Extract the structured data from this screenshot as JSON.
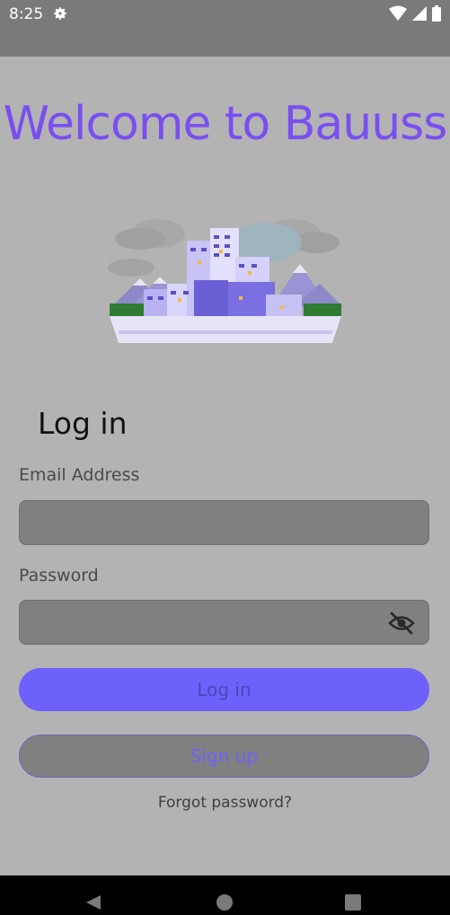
{
  "status_bar": {
    "time": "8:25",
    "icons": [
      "gear-icon",
      "wifi-icon",
      "signal-icon",
      "battery-icon"
    ]
  },
  "main": {
    "title": "Welcome to Bauuss",
    "login_heading": "Log in",
    "email": {
      "label": "Email Address",
      "value": "",
      "placeholder": ""
    },
    "password": {
      "label": "Password",
      "value": "",
      "placeholder": ""
    },
    "login_button_label": "Log in",
    "signup_button_label": "Sign up",
    "forgot_password_label": "Forgot password?"
  },
  "nav_bar": {
    "icons": [
      "back-icon",
      "home-icon",
      "recents-icon"
    ]
  },
  "colors": {
    "accent": "#7a4ff0",
    "button_primary": "#6e61fb",
    "background": "#b3b3b3",
    "status_bar": "#7a7a7a",
    "field_fill": "#808080"
  }
}
